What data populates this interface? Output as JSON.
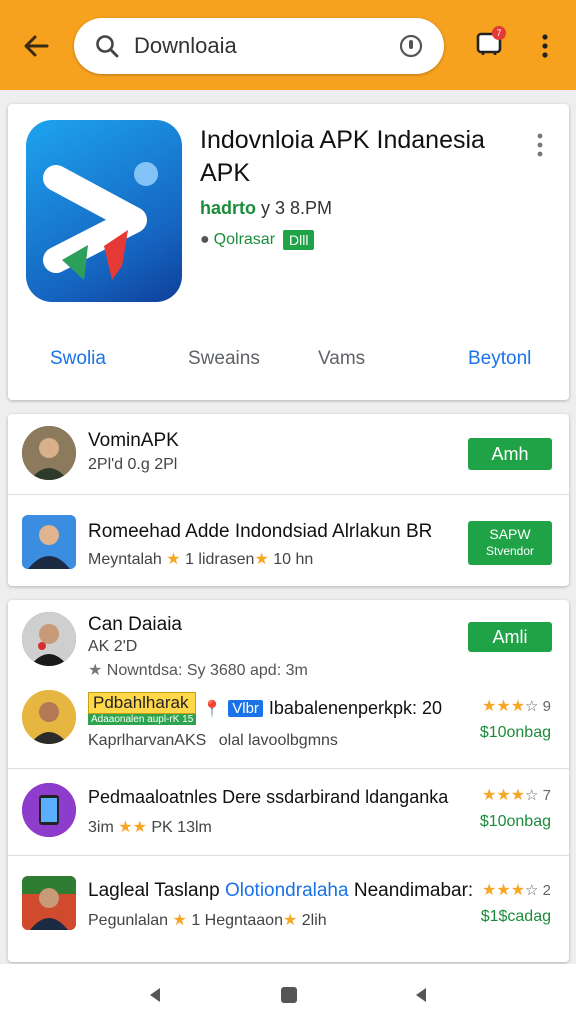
{
  "topbar": {
    "search_value": "Downloaia",
    "cart_badge": "7"
  },
  "app": {
    "title": "Indovnloia APK Indanesia APK",
    "developer": "hadrto",
    "developer_suffix": "y 3 8.PM",
    "rating_text": "Qolrasar",
    "badge": "Dlll",
    "tabs": [
      "Swolia",
      "Sweains",
      "Vams",
      "Beytonl"
    ]
  },
  "list1": [
    {
      "title": "VominAPK",
      "subtitle": "2Pl'd 0.g 2Pl",
      "button": "Amh"
    },
    {
      "title": "Romeehad Adde Indondsiad Alrlakun BR",
      "subtitle_a": "Meyntalah",
      "subtitle_b": "1 lidrasen",
      "subtitle_c": "10 hn",
      "button_line1": "SAPW",
      "button_line2": "Stvendor"
    }
  ],
  "list2": {
    "header": {
      "title": "Can Daiaia",
      "line2": "AK 2'D",
      "line3_a": "Nowntdsa: Sy 3680 apd: 3m",
      "button": "Amli"
    },
    "rows": [
      {
        "chip_yellow": "Pdbahlharak",
        "chip_sub": "Adaaonalen aupl-rK 15",
        "chip_blue": "Vlbr",
        "title": "Ibabalenenperkpk: 20",
        "subtitle_a": "KaprlharvanAKS",
        "subtitle_b": "olal lavoolbgmns",
        "stars": "★★★",
        "stars_rest": "☆ 9",
        "price": "$10onbag"
      },
      {
        "title": "Pedmaaloatnles Dere ssdarbirand ldanganka",
        "subtitle_a": "3im",
        "subtitle_b": "PK 13lm",
        "stars": "★★★",
        "stars_rest": "☆ 7",
        "price": "$10onbag"
      },
      {
        "title_a": "Lagleal Taslanp ",
        "title_b": "Olotiondralaha",
        "title_c": " Neandimabar:",
        "subtitle_a": "Pegunlalan",
        "subtitle_b": "1 Hegntaaon",
        "subtitle_c": "2lih",
        "stars": "★★★",
        "stars_rest": "☆ 2",
        "price": "$1$cadag"
      }
    ]
  },
  "colors": {
    "topbar": "#f7a21f",
    "green": "#1fa346",
    "blue": "#1a73e8",
    "star": "#f5a623"
  },
  "icons": {
    "back": "arrow-left-icon",
    "search": "search-icon",
    "mic": "mic-icon",
    "cart": "cart-icon",
    "more": "more-vert-icon",
    "nav_back": "triangle-left-icon",
    "nav_home": "square-icon",
    "nav_recent": "triangle-left-icon"
  }
}
